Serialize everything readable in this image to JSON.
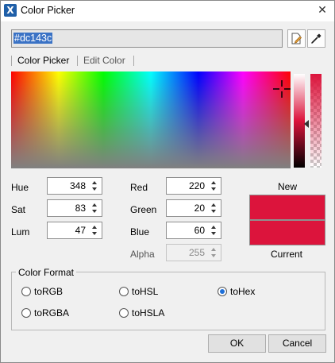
{
  "window": {
    "title": "Color Picker",
    "app_icon": "X"
  },
  "hex": {
    "value": "#dc143c"
  },
  "tabs": [
    {
      "label": "Color Picker"
    },
    {
      "label": "Edit Color"
    }
  ],
  "fields": {
    "hue": {
      "label": "Hue",
      "value": "348"
    },
    "sat": {
      "label": "Sat",
      "value": "83"
    },
    "lum": {
      "label": "Lum",
      "value": "47"
    },
    "red": {
      "label": "Red",
      "value": "220"
    },
    "green": {
      "label": "Green",
      "value": "20"
    },
    "blue": {
      "label": "Blue",
      "value": "60"
    },
    "alpha": {
      "label": "Alpha",
      "value": "255"
    }
  },
  "preview": {
    "new_label": "New",
    "current_label": "Current",
    "new_color": "#dc143c",
    "current_color": "#dc143c"
  },
  "format": {
    "title": "Color Format",
    "options": [
      {
        "label": "toRGB",
        "checked": false
      },
      {
        "label": "toHSL",
        "checked": false
      },
      {
        "label": "toHex",
        "checked": true
      },
      {
        "label": "toRGBA",
        "checked": false
      },
      {
        "label": "toHSLA",
        "checked": false
      }
    ]
  },
  "buttons": {
    "ok": "OK",
    "cancel": "Cancel"
  },
  "icons": {
    "edit": "edit-icon",
    "eyedropper": "eyedropper-icon",
    "close": "close-icon"
  }
}
